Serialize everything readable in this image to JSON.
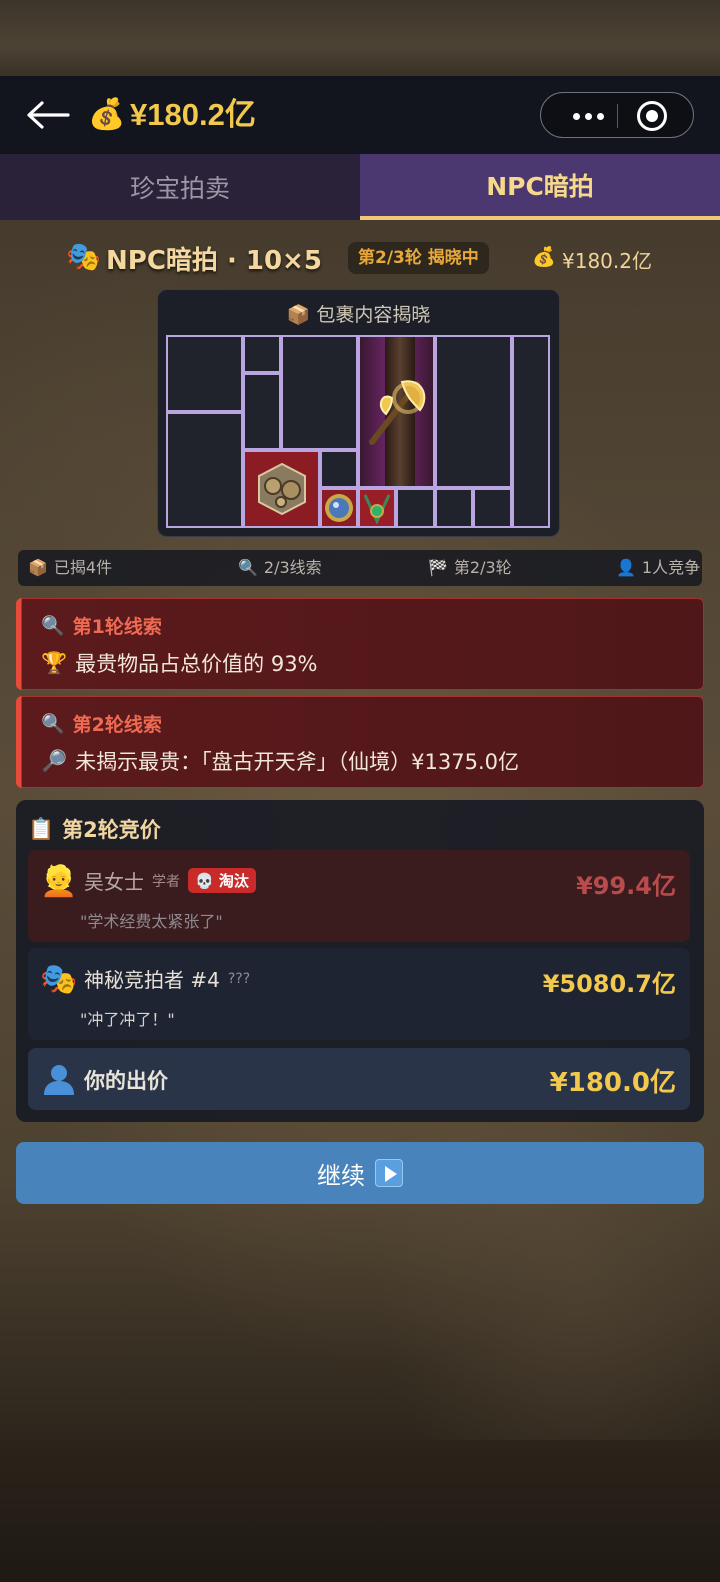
{
  "header": {
    "balance_icon": "money-bag-icon",
    "balance": "¥180.2亿"
  },
  "tabs": [
    {
      "label": "珍宝拍卖",
      "active": false
    },
    {
      "label": "NPC暗拍",
      "active": true
    }
  ],
  "auction": {
    "title": "NPC暗拍 · 10×5",
    "round_badge": "第2/3轮 揭晓中",
    "balance": "¥180.2亿"
  },
  "reveal": {
    "title": "包裹内容揭晓"
  },
  "stats": {
    "revealed": "已揭4件",
    "clues": "2/3线索",
    "round": "第2/3轮",
    "competitors": "1人竞争"
  },
  "clues": [
    {
      "title": "第1轮线索",
      "text": "最贵物品占总价值的 93%"
    },
    {
      "title": "第2轮线索",
      "text": "未揭示最贵：「盘古开天斧」（仙境）¥1375.0亿"
    }
  ],
  "bidding": {
    "title": "第2轮竞价",
    "bidders": [
      {
        "name": "吴女士",
        "tag": "学者",
        "status": "淘汰",
        "amount": "¥99.4亿",
        "quote": "\"学术经费太紧张了\""
      },
      {
        "name": "神秘竞拍者 #4",
        "tag": "???",
        "amount": "¥5080.7亿",
        "quote": "\"冲了冲了！\""
      }
    ],
    "my_bid_label": "你的出价",
    "my_bid_amount": "¥180.0亿"
  },
  "continue_label": "继续",
  "colors": {
    "gold": "#f2c94c",
    "tab_active_bg": "#4b3870",
    "clue_border": "#e84a3c",
    "button_bg": "#4883bb"
  }
}
